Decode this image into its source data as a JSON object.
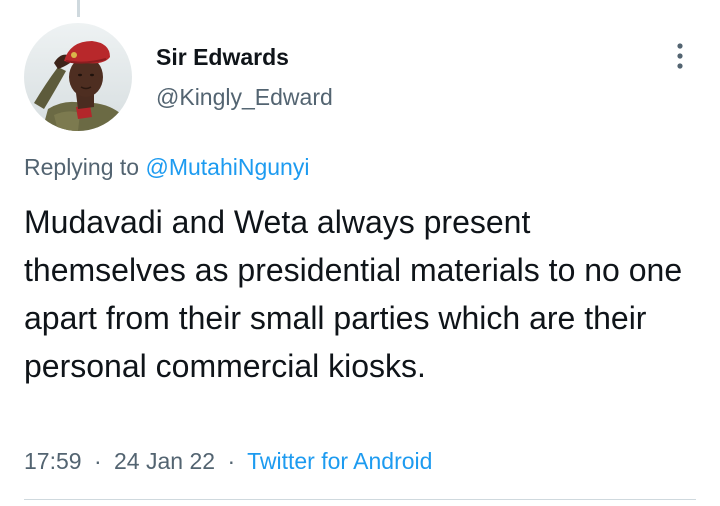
{
  "tweet": {
    "author_name": "Sir Edwards",
    "author_handle": "@Kingly_Edward",
    "replying_prefix": "Replying to",
    "replying_to": "@MutahiNgunyi",
    "text": "Mudavadi and Weta always present themselves as presidential materials to no one apart from their small parties which are their personal commercial kiosks.",
    "time": "17:59",
    "date": "24 Jan 22",
    "source": "Twitter for Android",
    "separator": "·"
  },
  "icons": {
    "more": "more-options-vertical-icon",
    "avatar": "profile-photo-saluting-man-red-beret"
  },
  "colors": {
    "primary_text": "#0f1419",
    "secondary_text": "#536471",
    "link": "#1d9bf0",
    "divider": "#cfd9de",
    "background": "#ffffff"
  }
}
